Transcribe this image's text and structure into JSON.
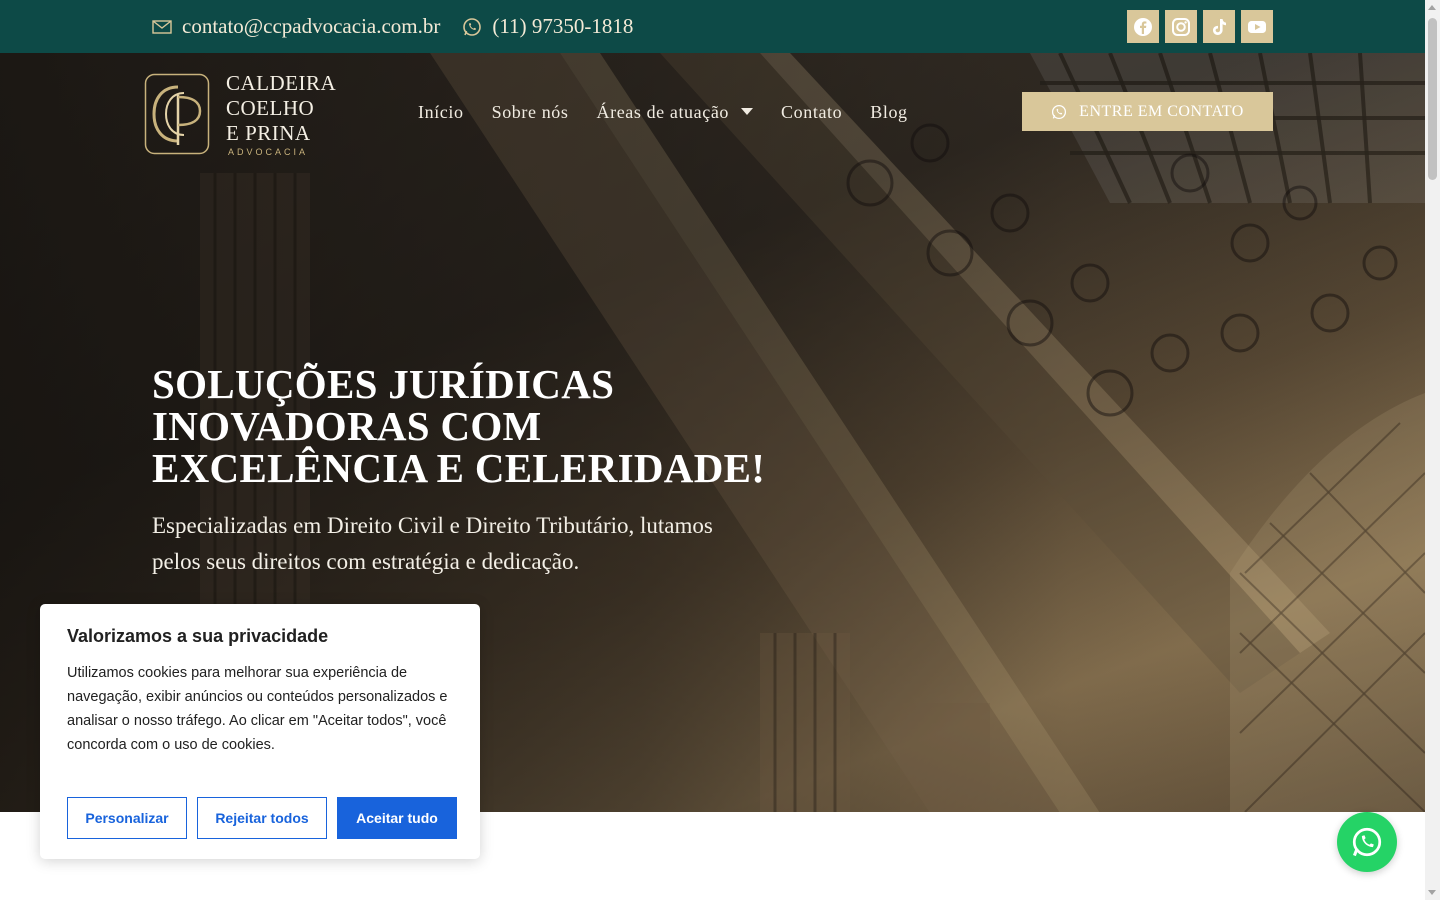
{
  "topbar": {
    "email": "contato@ccpadvocacia.com.br",
    "phone": "(11) 97350-1818",
    "socials": [
      "facebook-icon",
      "instagram-icon",
      "tiktok-icon",
      "youtube-icon"
    ]
  },
  "logo": {
    "line1": "CALDEIRA",
    "line2": "COELHO",
    "line3": "E PRINA",
    "sub": "ADVOCACIA"
  },
  "nav": {
    "items": [
      "Início",
      "Sobre nós",
      "Áreas de atuação",
      "Contato",
      "Blog"
    ]
  },
  "cta": {
    "label": "ENTRE EM CONTATO"
  },
  "hero": {
    "headline": "SOLUÇÕES JURÍDICAS INOVADORAS COM EXCELÊNCIA E CELERIDADE!",
    "subheadline": "Especializadas em Direito Civil e Direito Tributário, lutamos pelos seus direitos com estratégia e dedicação."
  },
  "cookie": {
    "title": "Valorizamos a sua privacidade",
    "text": "Utilizamos cookies para melhorar sua experiência de navegação, exibir anúncios ou conteúdos personalizados e analisar o nosso tráfego. Ao clicar em \"Aceitar todos\", você concorda com o uso de cookies.",
    "customize": "Personalizar",
    "reject": "Rejeitar todos",
    "accept": "Aceitar tudo"
  },
  "colors": {
    "topbar": "#0d4a47",
    "gold": "#d9c79a",
    "cookie_blue": "#1863dc",
    "whatsapp": "#25d366"
  }
}
